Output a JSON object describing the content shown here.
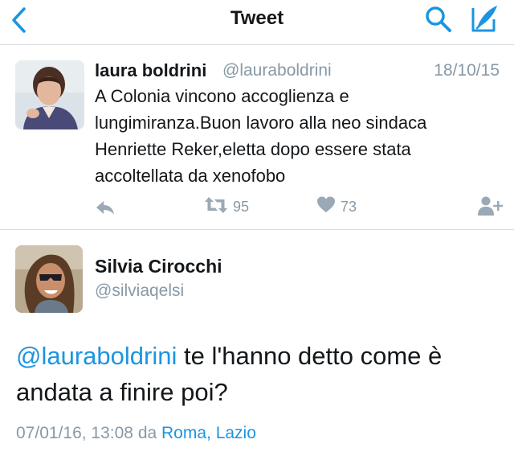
{
  "nav": {
    "title": "Tweet"
  },
  "quoted_tweet": {
    "name": "laura boldrini",
    "handle": "@lauraboldrini",
    "date": "18/10/15",
    "text": "A Colonia vincono accoglienza e lungimiranza.Buon lavoro alla neo sindaca Henriette Reker,eletta dopo essere stata accoltellata da xenofobo",
    "retweet_count": "95",
    "like_count": "73"
  },
  "tweet": {
    "name": "Silvia Cirocchi",
    "handle": "@silviaqelsi",
    "mention": "@lauraboldrini",
    "text": " te l'hanno detto come è andata a finire poi?",
    "timestamp": "07/01/16, 13:08",
    "via_label": "da",
    "location": "Roma, Lazio"
  },
  "colors": {
    "accent": "#1b95e0",
    "muted": "#8899a6",
    "text": "#14171a",
    "divider": "#d8dde1"
  }
}
